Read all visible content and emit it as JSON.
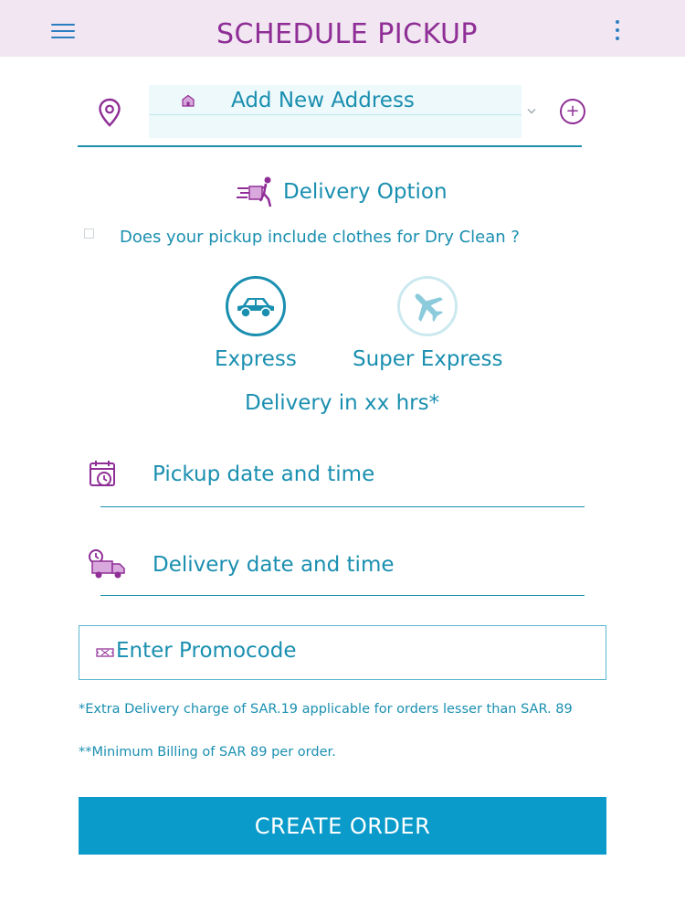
{
  "colors": {
    "appbar_bg": "#f1e6f1",
    "title": "#8f2e96",
    "accent": "#1a8fb0",
    "button_bg": "#0b9bcb",
    "address_bg": "#eef9fb"
  },
  "header": {
    "title": "SCHEDULE PICKUP",
    "menu_icon": "hamburger-menu-icon",
    "more_icon": "more-vertical-icon"
  },
  "address": {
    "selected": "Add New Address",
    "location_icon": "location-pin-icon",
    "home_icon": "house-icon",
    "dropdown_icon": "chevron-down-icon",
    "add_icon": "plus-circle-icon"
  },
  "delivery": {
    "title": "Delivery Option",
    "title_icon": "delivery-person-icon",
    "dry_clean_question": "Does your pickup include clothes for Dry Clean ?",
    "dry_clean_checked": false,
    "options": [
      {
        "label": "Express",
        "icon": "car-icon",
        "selected": true
      },
      {
        "label": "Super Express",
        "icon": "airplane-icon",
        "selected": false
      }
    ],
    "time_note": "Delivery in xx hrs*"
  },
  "schedule": {
    "pickup_label": "Pickup date and time",
    "pickup_icon": "calendar-clock-icon",
    "delivery_label": "Delivery date and time",
    "delivery_icon": "delivery-truck-clock-icon"
  },
  "promo": {
    "placeholder": "Enter Promocode",
    "value": "",
    "icon": "promo-ticket-icon"
  },
  "notes": {
    "extra_charge": "*Extra Delivery charge of SAR.19 applicable for orders lesser than SAR. 89",
    "minimum_billing": "**Minimum Billing of SAR 89 per order."
  },
  "actions": {
    "create_order": "CREATE ORDER"
  }
}
